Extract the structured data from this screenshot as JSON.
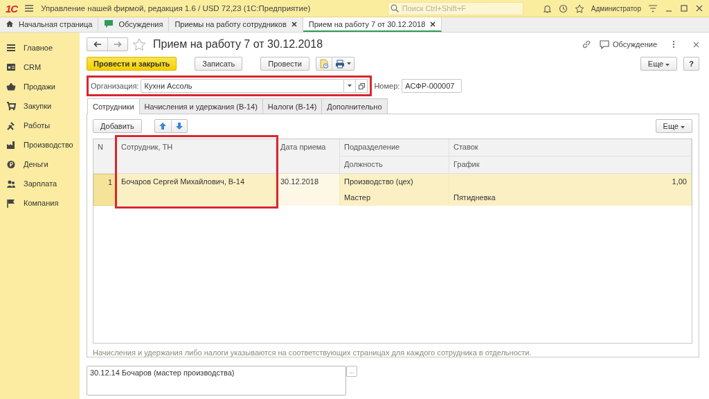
{
  "app_bar": {
    "logo": "1С",
    "title": "Управление нашей фирмой, редакция 1.6 / USD 72,23  (1С:Предприятие)",
    "search": {
      "placeholder": "Поиск Ctrl+Shift+F"
    },
    "user": "Администратор"
  },
  "open_tabs": [
    {
      "kind": "home",
      "label": "Начальная страница",
      "closable": false,
      "selected": false
    },
    {
      "kind": "discussions",
      "label": "Обсуждения",
      "closable": false,
      "selected": false
    },
    {
      "kind": "page",
      "label": "Приемы на работу сотрудников",
      "closable": true,
      "selected": false
    },
    {
      "kind": "page",
      "label": "Прием на работу 7 от 30.12.2018",
      "closable": true,
      "selected": true
    }
  ],
  "sidebar": {
    "items": [
      {
        "label": "Главное"
      },
      {
        "label": "CRM"
      },
      {
        "label": "Продажи"
      },
      {
        "label": "Закупки"
      },
      {
        "label": "Работы"
      },
      {
        "label": "Производство"
      },
      {
        "label": "Деньги"
      },
      {
        "label": "Зарплата"
      },
      {
        "label": "Компания"
      }
    ]
  },
  "document": {
    "title": "Прием на работу 7 от 30.12.2018",
    "favorite": false,
    "discussion": "Обсуждение",
    "commands": [
      {
        "kind": "primary",
        "label": "Провести и закрыть"
      },
      {
        "kind": "plain",
        "label": "Записать"
      },
      {
        "kind": "plain",
        "label": "Провести"
      }
    ],
    "more": "Еще",
    "help": "?",
    "organization": {
      "label": "Организация:",
      "value": "Кухни Ассоль",
      "highlighted": true
    },
    "number": {
      "label": "Номер:",
      "value": "АСФР-000007"
    },
    "tabs": [
      {
        "label": "Сотрудники",
        "selected": true
      },
      {
        "label": "Начисления и удержания (В-14)",
        "selected": false
      },
      {
        "label": "Налоги (В-14)",
        "selected": false
      },
      {
        "label": "Дополнительно",
        "selected": false
      }
    ],
    "table_toolbar": {
      "add": "Добавить",
      "more": "Еще"
    },
    "table": {
      "columns": [
        {
          "header": "N",
          "highlighted": false
        },
        {
          "header": "Сотрудник, ТН",
          "highlighted": true
        },
        {
          "header": "Дата приема",
          "highlighted": false
        },
        {
          "header": "Подразделение",
          "subheader": "Должность",
          "highlighted": false
        },
        {
          "header": "Ставок",
          "subheader": "График",
          "highlighted": false
        }
      ],
      "rows": [
        {
          "selected": true,
          "cells": [
            [
              "1"
            ],
            [
              "Бочаров Сергей Михайлович, В-14"
            ],
            [
              "30.12.2018"
            ],
            [
              "Производство (цех)",
              "Мастер"
            ],
            [
              "1,00",
              "Пятидневка"
            ]
          ]
        }
      ]
    },
    "note": "Начисления и удержания либо налоги указываются на соответствующих страницах для каждого сотрудника в отдельности.",
    "comment": {
      "value": "30.12.14 Бочаров (мастер производства)",
      "button": "..."
    }
  }
}
